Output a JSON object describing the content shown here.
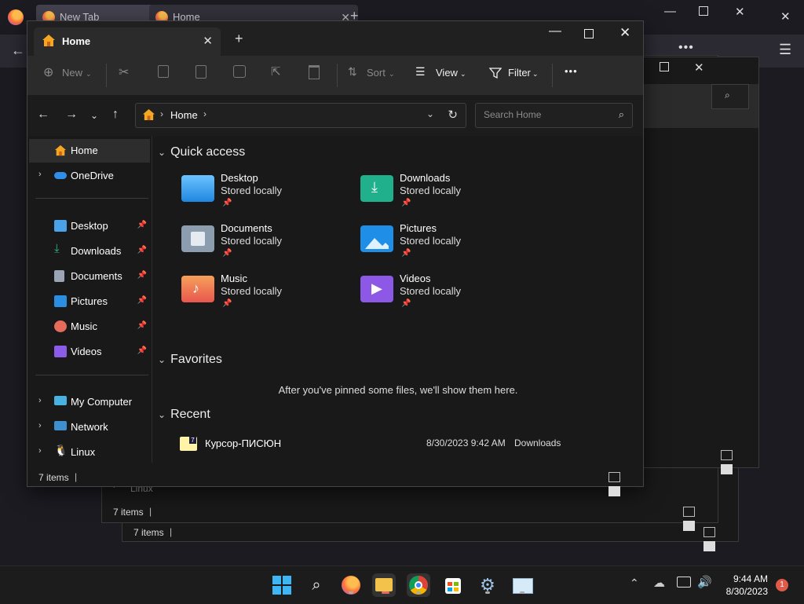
{
  "browser": {
    "tabs": [
      {
        "label": "New Tab"
      },
      {
        "label": "Home"
      }
    ]
  },
  "window": {
    "tab_label": "Home",
    "ribbon": {
      "new": "New",
      "sort": "Sort",
      "view": "View",
      "filter": "Filter",
      "more": "•••"
    },
    "address": {
      "crumb": "Home"
    },
    "search": {
      "placeholder": "Search Home"
    },
    "sidebar": {
      "home": "Home",
      "onedrive": "OneDrive",
      "pinned": [
        {
          "label": "Desktop",
          "icon": "desktop-icon",
          "color": "#4aa3e8"
        },
        {
          "label": "Downloads",
          "icon": "downloads-icon",
          "color": "#2fb58a"
        },
        {
          "label": "Documents",
          "icon": "documents-icon",
          "color": "#9aa4b2"
        },
        {
          "label": "Pictures",
          "icon": "pictures-icon",
          "color": "#2c8ee0"
        },
        {
          "label": "Music",
          "icon": "music-icon",
          "color": "#e56b5b"
        },
        {
          "label": "Videos",
          "icon": "videos-icon",
          "color": "#8b5ce8"
        }
      ],
      "locations": [
        {
          "label": "My Computer",
          "icon": "computer-icon"
        },
        {
          "label": "Network",
          "icon": "network-icon"
        },
        {
          "label": "Linux",
          "icon": "linux-icon"
        }
      ]
    },
    "quick_access": {
      "title": "Quick access",
      "items": [
        {
          "name": "Desktop",
          "sub": "Stored locally",
          "color": "#3aa0ea"
        },
        {
          "name": "Downloads",
          "sub": "Stored locally",
          "color": "#21b08c"
        },
        {
          "name": "Documents",
          "sub": "Stored locally",
          "color": "#8c9db0"
        },
        {
          "name": "Pictures",
          "sub": "Stored locally",
          "color": "#1f8ee6"
        },
        {
          "name": "Music",
          "sub": "Stored locally",
          "color": "#ef6d50"
        },
        {
          "name": "Videos",
          "sub": "Stored locally",
          "color": "#8d58e6"
        }
      ]
    },
    "favorites": {
      "title": "Favorites",
      "empty_message": "After you've pinned some files, we'll show them here."
    },
    "recent": {
      "title": "Recent",
      "items": [
        {
          "name": "Курсор-ПИСЮН",
          "date": "8/30/2023 9:42 AM",
          "location": "Downloads"
        }
      ]
    },
    "status": "7 items"
  },
  "bg_windows": [
    {
      "status": "7 items",
      "linux": "Linux"
    },
    {
      "status": "7 items"
    }
  ],
  "taskbar": {
    "time": "9:44 AM",
    "date": "8/30/2023",
    "notifications": "1"
  }
}
